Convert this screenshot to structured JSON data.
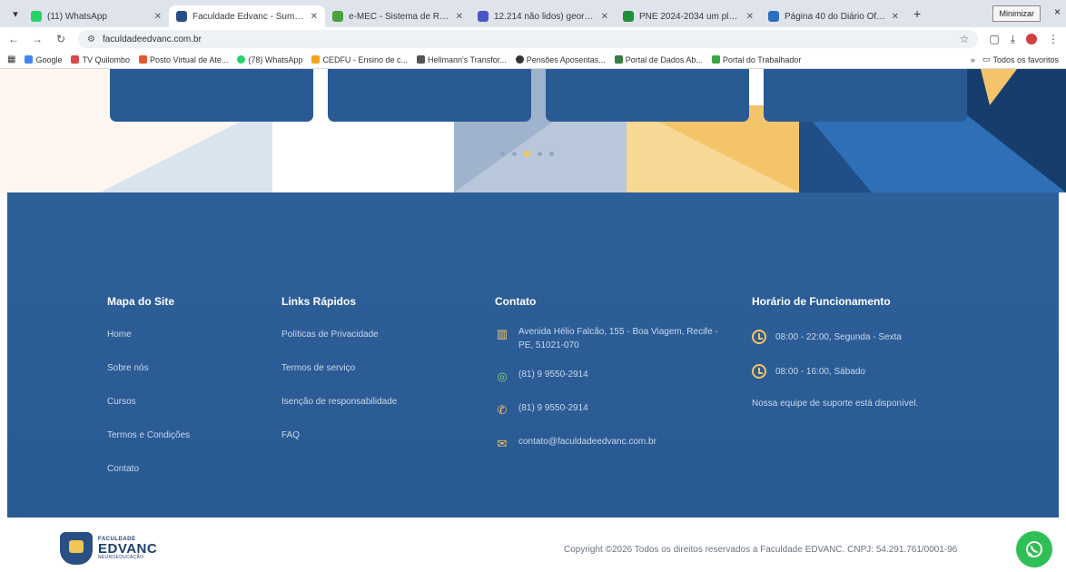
{
  "browser": {
    "tabs": [
      {
        "title": "(11) WhatsApp",
        "favicon_color": "#25d366",
        "active": false
      },
      {
        "title": "Faculdade Edvanc - Summ...",
        "favicon_color": "#2a4f84",
        "active": true
      },
      {
        "title": "e-MEC - Sistema de Regula...",
        "favicon_color": "#48a23f",
        "active": false
      },
      {
        "title": "12.214 não lidos) george.o...",
        "favicon_color": "#4a56c5",
        "active": false
      },
      {
        "title": "PNE 2024-2034 um plano...",
        "favicon_color": "#1f8f3a",
        "active": false
      },
      {
        "title": "Página 40 do Diário Oficial...",
        "favicon_color": "#2c6fbf",
        "active": false
      }
    ],
    "new_tab": "+",
    "minimize_tooltip": "Minimizar",
    "close": "×",
    "url": "faculdadeedvanc.com.br",
    "bookmarks": [
      {
        "label": "Google",
        "color": "#4285f4"
      },
      {
        "label": "TV Quilombo",
        "color": "#d64b4b"
      },
      {
        "label": "Posto Virtual de Ate...",
        "color": "#e35a2b"
      },
      {
        "label": "(78) WhatsApp",
        "color": "#25d366"
      },
      {
        "label": "CEDFU - Ensino de c...",
        "color": "#f2a51c"
      },
      {
        "label": "Hellmann's Transfor...",
        "color": "#555555"
      },
      {
        "label": "Pensões Aposentas...",
        "color": "#333333"
      },
      {
        "label": "Portal de Dados Ab...",
        "color": "#3a7d44"
      },
      {
        "label": "Portal do Trabalhador",
        "color": "#3aa640"
      }
    ],
    "bookmarks_more": "»",
    "all_bookmarks": "Todos os favoritos"
  },
  "footer": {
    "sitemap": {
      "title": "Mapa do Site",
      "links": [
        "Home",
        "Sobre nós",
        "Cursos",
        "Termos e Condições",
        "Contato"
      ]
    },
    "quick_links": {
      "title": "Links Rápidos",
      "links": [
        "Políticas de Privacidade",
        "Termos de serviço",
        "Isenção de responsabilidade",
        "FAQ"
      ]
    },
    "contact": {
      "title": "Contato",
      "address": "Avenida Hélio Falcão, 155 - Boa Viagem, Recife - PE, 51021-070",
      "whatsapp": "(81) 9 9550-2914",
      "phone": "(81) 9 9550-2914",
      "email": "contato@faculdadeedvanc.com.br"
    },
    "hours": {
      "title": "Horário de Funcionamento",
      "weekday": "08:00 - 22:00, Segunda - Sexta",
      "saturday": "08:00 - 16:00, Sábado",
      "note": "Nossa equipe de suporte está disponível."
    }
  },
  "bottom": {
    "logo": {
      "small": "FACULDADE",
      "main": "EDVANC",
      "sub": "NEUROEDUCAÇÃO"
    },
    "copyright": "Copyright ©2026 Todos os direitos reservados a Faculdade EDVANC. CNPJ: 54.291.761/0001-96"
  },
  "carousel": {
    "dots": 5,
    "active_index": 2
  }
}
